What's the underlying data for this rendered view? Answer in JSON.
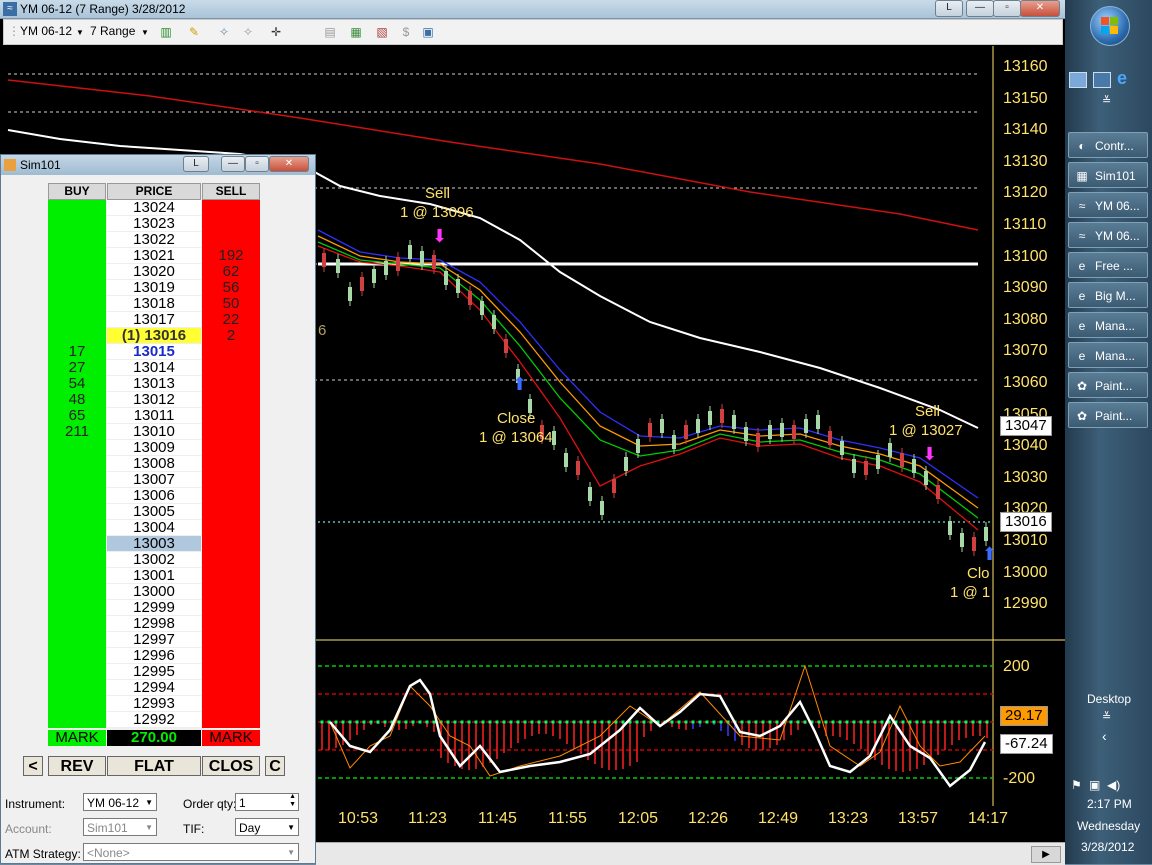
{
  "window": {
    "title": "YM 06-12 (7 Range)  3/28/2012",
    "restore_label": "L"
  },
  "toolbar": {
    "instrument": "YM 06-12",
    "period": "7 Range"
  },
  "chart": {
    "y_labels": [
      "13160",
      "13150",
      "13140",
      "13130",
      "13120",
      "13110",
      "13100",
      "13090",
      "13080",
      "13070",
      "13060",
      "13050",
      "13040",
      "13030",
      "13020",
      "13010",
      "13000",
      "12990"
    ],
    "x_labels": [
      "10:53",
      "11:23",
      "11:45",
      "11:55",
      "12:05",
      "12:26",
      "12:49",
      "13:23",
      "13:57",
      "14:17"
    ],
    "price_tags": {
      "upper": "13047",
      "current": "13016"
    },
    "annotations": {
      "sell1_a": "Sell",
      "sell1_b": "1 @ 13096",
      "close1_a": "Close",
      "close1_b": "1 @ 13064",
      "sell2_a": "Sell",
      "sell2_b": "1 @ 13027",
      "close2_a": "Clo",
      "close2_b": "1 @ 1",
      "partial_label": "6"
    },
    "osc_labels": [
      "200",
      "-200"
    ],
    "osc_tags": {
      "value1": "29.17",
      "value2": "-67.24"
    }
  },
  "taskbar": {
    "tasks": [
      "Contr...",
      "Sim101",
      "YM 06...",
      "YM 06...",
      "Free ...",
      "Big M...",
      "Mana...",
      "Mana...",
      "Paint...",
      "Paint..."
    ],
    "desktop_label": "Desktop",
    "time": "2:17 PM",
    "day": "Wednesday",
    "date": "3/28/2012"
  },
  "dom": {
    "title": "Sim101",
    "title_btn": "L",
    "headers": {
      "buy": "BUY",
      "price": "PRICE",
      "sell": "SELL"
    },
    "rows": [
      {
        "buy": "",
        "price": "13024",
        "sell": ""
      },
      {
        "buy": "",
        "price": "13023",
        "sell": ""
      },
      {
        "buy": "",
        "price": "13022",
        "sell": ""
      },
      {
        "buy": "",
        "price": "13021",
        "sell": "192"
      },
      {
        "buy": "",
        "price": "13020",
        "sell": "62"
      },
      {
        "buy": "",
        "price": "13019",
        "sell": "56"
      },
      {
        "buy": "",
        "price": "13018",
        "sell": "50"
      },
      {
        "buy": "",
        "price": "13017",
        "sell": "22"
      },
      {
        "buy": "",
        "price": "(1) 13016",
        "sell": "2"
      },
      {
        "buy": "17",
        "price": "13015",
        "sell": ""
      },
      {
        "buy": "27",
        "price": "13014",
        "sell": ""
      },
      {
        "buy": "54",
        "price": "13013",
        "sell": ""
      },
      {
        "buy": "48",
        "price": "13012",
        "sell": ""
      },
      {
        "buy": "65",
        "price": "13011",
        "sell": ""
      },
      {
        "buy": "211",
        "price": "13010",
        "sell": ""
      },
      {
        "buy": "",
        "price": "13009",
        "sell": ""
      },
      {
        "buy": "",
        "price": "13008",
        "sell": ""
      },
      {
        "buy": "",
        "price": "13007",
        "sell": ""
      },
      {
        "buy": "",
        "price": "13006",
        "sell": ""
      },
      {
        "buy": "",
        "price": "13005",
        "sell": ""
      },
      {
        "buy": "",
        "price": "13004",
        "sell": ""
      },
      {
        "buy": "",
        "price": "13003",
        "sell": ""
      },
      {
        "buy": "",
        "price": "13002",
        "sell": ""
      },
      {
        "buy": "",
        "price": "13001",
        "sell": ""
      },
      {
        "buy": "",
        "price": "13000",
        "sell": ""
      },
      {
        "buy": "",
        "price": "12999",
        "sell": ""
      },
      {
        "buy": "",
        "price": "12998",
        "sell": ""
      },
      {
        "buy": "",
        "price": "12997",
        "sell": ""
      },
      {
        "buy": "",
        "price": "12996",
        "sell": ""
      },
      {
        "buy": "",
        "price": "12995",
        "sell": ""
      },
      {
        "buy": "",
        "price": "12994",
        "sell": ""
      },
      {
        "buy": "",
        "price": "12993",
        "sell": ""
      },
      {
        "buy": "",
        "price": "12992",
        "sell": ""
      }
    ],
    "footer": {
      "mark_buy": "MARK",
      "pnl": "270.00",
      "mark_sell": "MARK"
    },
    "buttons": {
      "left": "<",
      "rev": "REV",
      "flat": "FLAT",
      "close": "CLOS",
      "c": "C"
    },
    "form": {
      "instrument_label": "Instrument:",
      "instrument_value": "YM 06-12",
      "order_qty_label": "Order qty:",
      "order_qty_value": "1",
      "account_label": "Account:",
      "account_value": "Sim101",
      "tif_label": "TIF:",
      "tif_value": "Day",
      "atm_label": "ATM Strategy:",
      "atm_value": "<None>"
    },
    "colors": {
      "buy": "#00ee00",
      "sell": "#ff0000",
      "last": "#ffff33",
      "highlight": "#b0c8de"
    }
  }
}
